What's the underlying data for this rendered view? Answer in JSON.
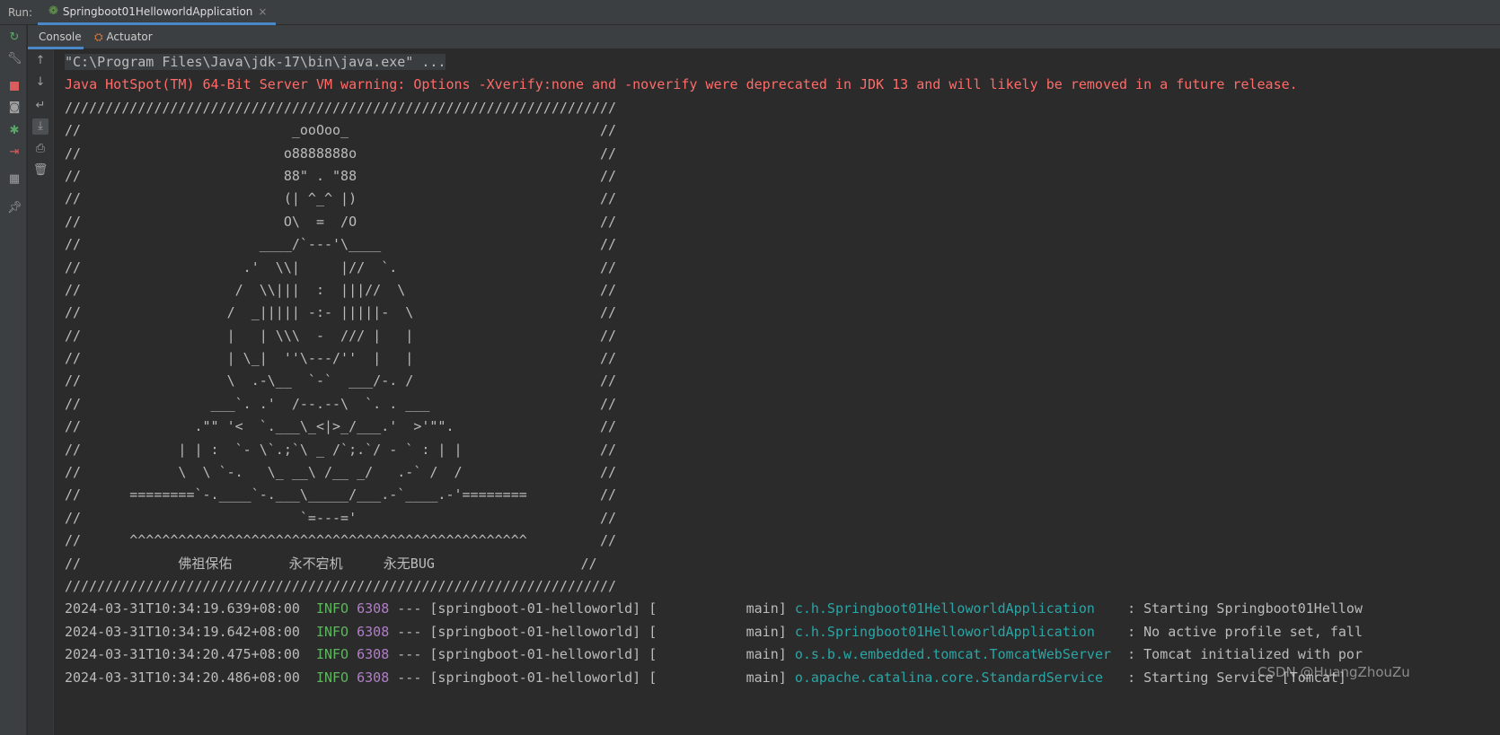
{
  "run_label": "Run:",
  "run_tab": "Springboot01HelloworldApplication",
  "run_tab_close": "×",
  "subtabs": [
    "Console",
    "Actuator"
  ],
  "left_icons": [
    "rerun-icon",
    "wrench-icon",
    "stop-icon",
    "camera-icon",
    "debug-icon",
    "exit-icon",
    "layout-icon",
    "pin-icon"
  ],
  "console_icons": [
    "arrow-up-icon",
    "arrow-down-icon",
    "soft-wrap-icon",
    "scroll-to-end-icon",
    "print-icon",
    "trash-icon"
  ],
  "console": {
    "command": "\"C:\\Program Files\\Java\\jdk-17\\bin\\java.exe\" ...",
    "warning": "Java HotSpot(TM) 64-Bit Server VM warning: Options -Xverify:none and -noverify were deprecated in JDK 13 and will likely be removed in a future release.",
    "banner": [
      "////////////////////////////////////////////////////////////////////",
      "//                          _ooOoo_                               //",
      "//                         o8888888o                              //",
      "//                         88\" . \"88                              //",
      "//                         (| ^_^ |)                              //",
      "//                         O\\  =  /O                              //",
      "//                      ____/`---'\\____                           //",
      "//                    .'  \\\\|     |//  `.                         //",
      "//                   /  \\\\|||  :  |||//  \\                        //",
      "//                  /  _||||| -:- |||||-  \\                       //",
      "//                  |   | \\\\\\  -  /// |   |                       //",
      "//                  | \\_|  ''\\---/''  |   |                       //",
      "//                  \\  .-\\__  `-`  ___/-. /                       //",
      "//                ___`. .'  /--.--\\  `. . ___                     //",
      "//              .\"\" '<  `.___\\_<|>_/___.'  >'\"\".                  //",
      "//            | | :  `- \\`.;`\\ _ /`;.`/ - ` : | |                 //",
      "//            \\  \\ `-.   \\_ __\\ /__ _/   .-` /  /                 //",
      "//      ========`-.____`-.___\\_____/___.-`____.-'========         //",
      "//                           `=---='                              //",
      "//      ^^^^^^^^^^^^^^^^^^^^^^^^^^^^^^^^^^^^^^^^^^^^^^^^^         //",
      "//            佛祖保佑       永不宕机     永无BUG                  //",
      "////////////////////////////////////////////////////////////////////"
    ],
    "logs": [
      {
        "ts": "2024-03-31T10:34:19.639+08:00",
        "level": "INFO",
        "pid": "6308",
        "sep": "---",
        "app": "[springboot-01-helloworld]",
        "thread": "[           main]",
        "logger": "c.h.Springboot01HelloworldApplication",
        "msg": ": Starting Springboot01Hellow"
      },
      {
        "ts": "2024-03-31T10:34:19.642+08:00",
        "level": "INFO",
        "pid": "6308",
        "sep": "---",
        "app": "[springboot-01-helloworld]",
        "thread": "[           main]",
        "logger": "c.h.Springboot01HelloworldApplication",
        "msg": ": No active profile set, fall"
      },
      {
        "ts": "2024-03-31T10:34:20.475+08:00",
        "level": "INFO",
        "pid": "6308",
        "sep": "---",
        "app": "[springboot-01-helloworld]",
        "thread": "[           main]",
        "logger": "o.s.b.w.embedded.tomcat.TomcatWebServer",
        "msg": ": Tomcat initialized with por"
      },
      {
        "ts": "2024-03-31T10:34:20.486+08:00",
        "level": "INFO",
        "pid": "6308",
        "sep": "---",
        "app": "[springboot-01-helloworld]",
        "thread": "[           main]",
        "logger": "o.apache.catalina.core.StandardService",
        "msg": ": Starting Service [Tomcat]"
      }
    ]
  },
  "watermark": "CSDN @HuangZhouZu"
}
